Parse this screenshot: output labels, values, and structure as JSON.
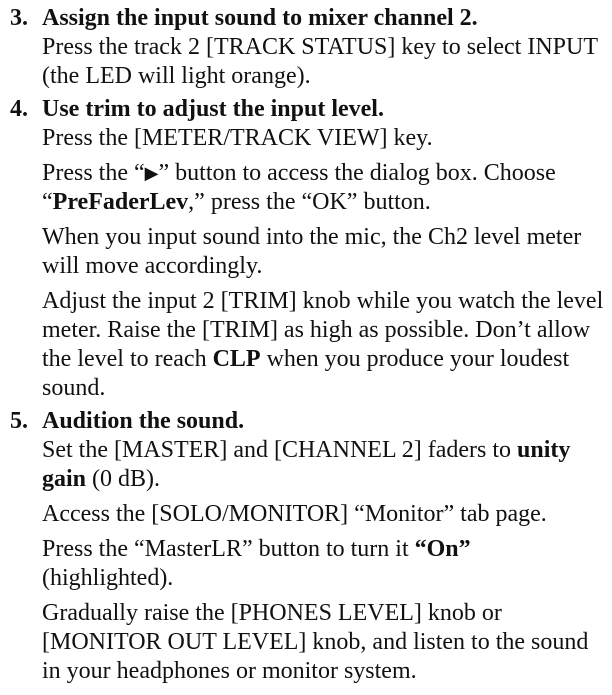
{
  "steps": [
    {
      "number": "3.",
      "title": "Assign the input sound to mixer channel 2.",
      "paragraphs": [
        {
          "text": "Press the track 2 [TRACK STATUS] key to select INPUT (the LED will light orange)."
        }
      ]
    },
    {
      "number": "4.",
      "title": "Use trim to adjust the input level.",
      "p1": "Press the [METER/TRACK VIEW] key.",
      "p2": {
        "a": "Press the “",
        "icon": "play-icon",
        "b": "” button to access the dialog box. Choose “",
        "bold": "PreFaderLev",
        "c": ",” press the “OK” button."
      },
      "p3": "When you input sound into the mic, the Ch2 level meter will move accordingly.",
      "p4": {
        "a": "Adjust the input 2 [TRIM] knob while you watch the level meter. Raise the [TRIM] as high as possible. Don’t allow the level to reach ",
        "bold": "CLP",
        "b": " when you produce your loudest sound."
      }
    },
    {
      "number": "5.",
      "title": "Audition the sound.",
      "p1": {
        "a": "Set the [MASTER] and [CHANNEL 2] faders to ",
        "bold": "unity gain",
        "b": " (0 dB)."
      },
      "p2": "Access the [SOLO/MONITOR] “Monitor” tab page.",
      "p3": {
        "a": "Press the “MasterLR” button to turn it ",
        "bold": "“On”",
        "b": " (highlighted)."
      },
      "p4": "Gradually raise the [PHONES LEVEL] knob or [MONITOR OUT LEVEL] knob, and listen to the sound in your headphones or monitor system."
    }
  ]
}
